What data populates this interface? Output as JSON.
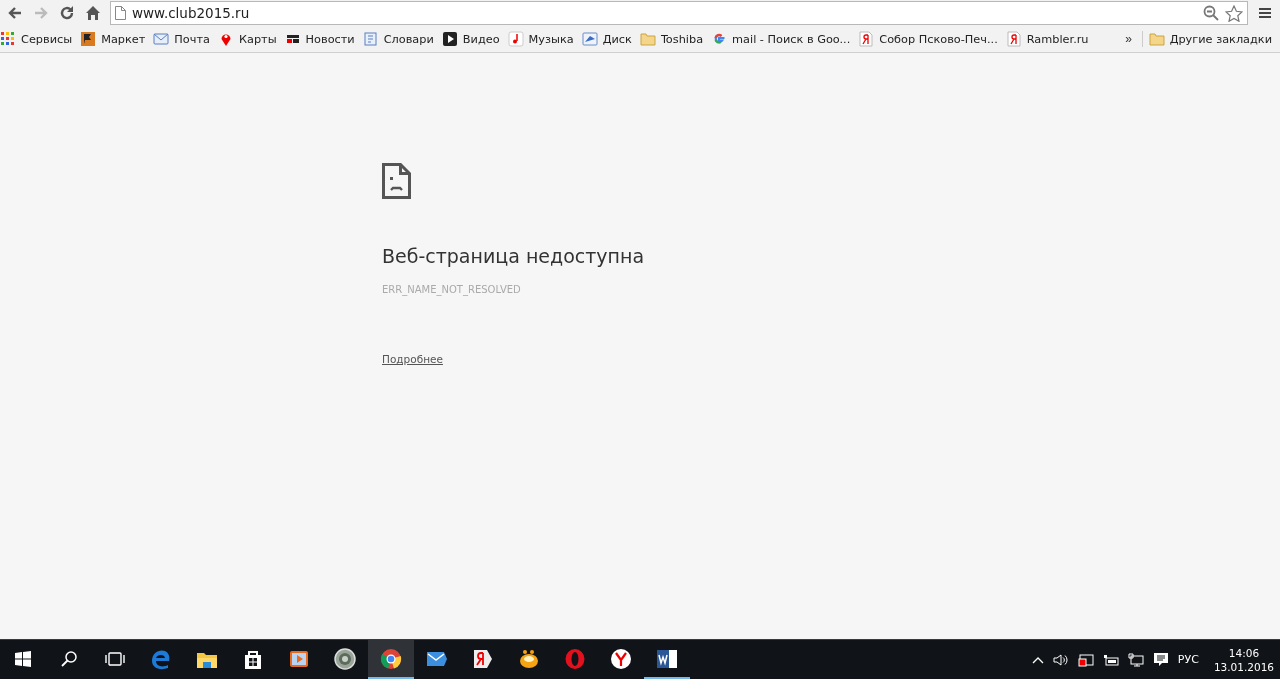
{
  "toolbar": {
    "url": "www.club2015.ru",
    "forward_disabled": true
  },
  "bookmarks": [
    {
      "label": "Сервисы",
      "kind": "apps"
    },
    {
      "label": "Маркет",
      "kind": "market"
    },
    {
      "label": "Почта",
      "kind": "mail"
    },
    {
      "label": "Карты",
      "kind": "pin"
    },
    {
      "label": "Новости",
      "kind": "news"
    },
    {
      "label": "Словари",
      "kind": "dict"
    },
    {
      "label": "Видео",
      "kind": "video"
    },
    {
      "label": "Музыка",
      "kind": "music"
    },
    {
      "label": "Диск",
      "kind": "disk"
    },
    {
      "label": "Toshiba",
      "kind": "folder"
    },
    {
      "label": "mail - Поиск в Goo...",
      "kind": "google"
    },
    {
      "label": "Собор Псково-Печ...",
      "kind": "yandex"
    },
    {
      "label": "Rambler.ru",
      "kind": "yandex"
    }
  ],
  "overflow": "»",
  "other_bookmarks": {
    "label": "Другие закладки",
    "kind": "folder"
  },
  "error": {
    "title": "Веб-страница недоступна",
    "code": "ERR_NAME_NOT_RESOLVED",
    "details_link": "Подробнее"
  },
  "taskbar": {
    "apps": [
      {
        "kind": "edge",
        "selected": false,
        "running": false
      },
      {
        "kind": "explorer",
        "selected": false,
        "running": false
      },
      {
        "kind": "store",
        "selected": false,
        "running": false
      },
      {
        "kind": "player",
        "selected": false,
        "running": false
      },
      {
        "kind": "disc",
        "selected": false,
        "running": false
      },
      {
        "kind": "chrome",
        "selected": true,
        "running": true
      },
      {
        "kind": "mail",
        "selected": false,
        "running": false
      },
      {
        "kind": "yabrowser",
        "selected": false,
        "running": false
      },
      {
        "kind": "orange",
        "selected": false,
        "running": false
      },
      {
        "kind": "opera",
        "selected": false,
        "running": false
      },
      {
        "kind": "yandex",
        "selected": false,
        "running": false
      },
      {
        "kind": "word",
        "selected": false,
        "running": true
      }
    ],
    "language": "РУС",
    "time": "14:06",
    "date": "13.01.2016"
  }
}
